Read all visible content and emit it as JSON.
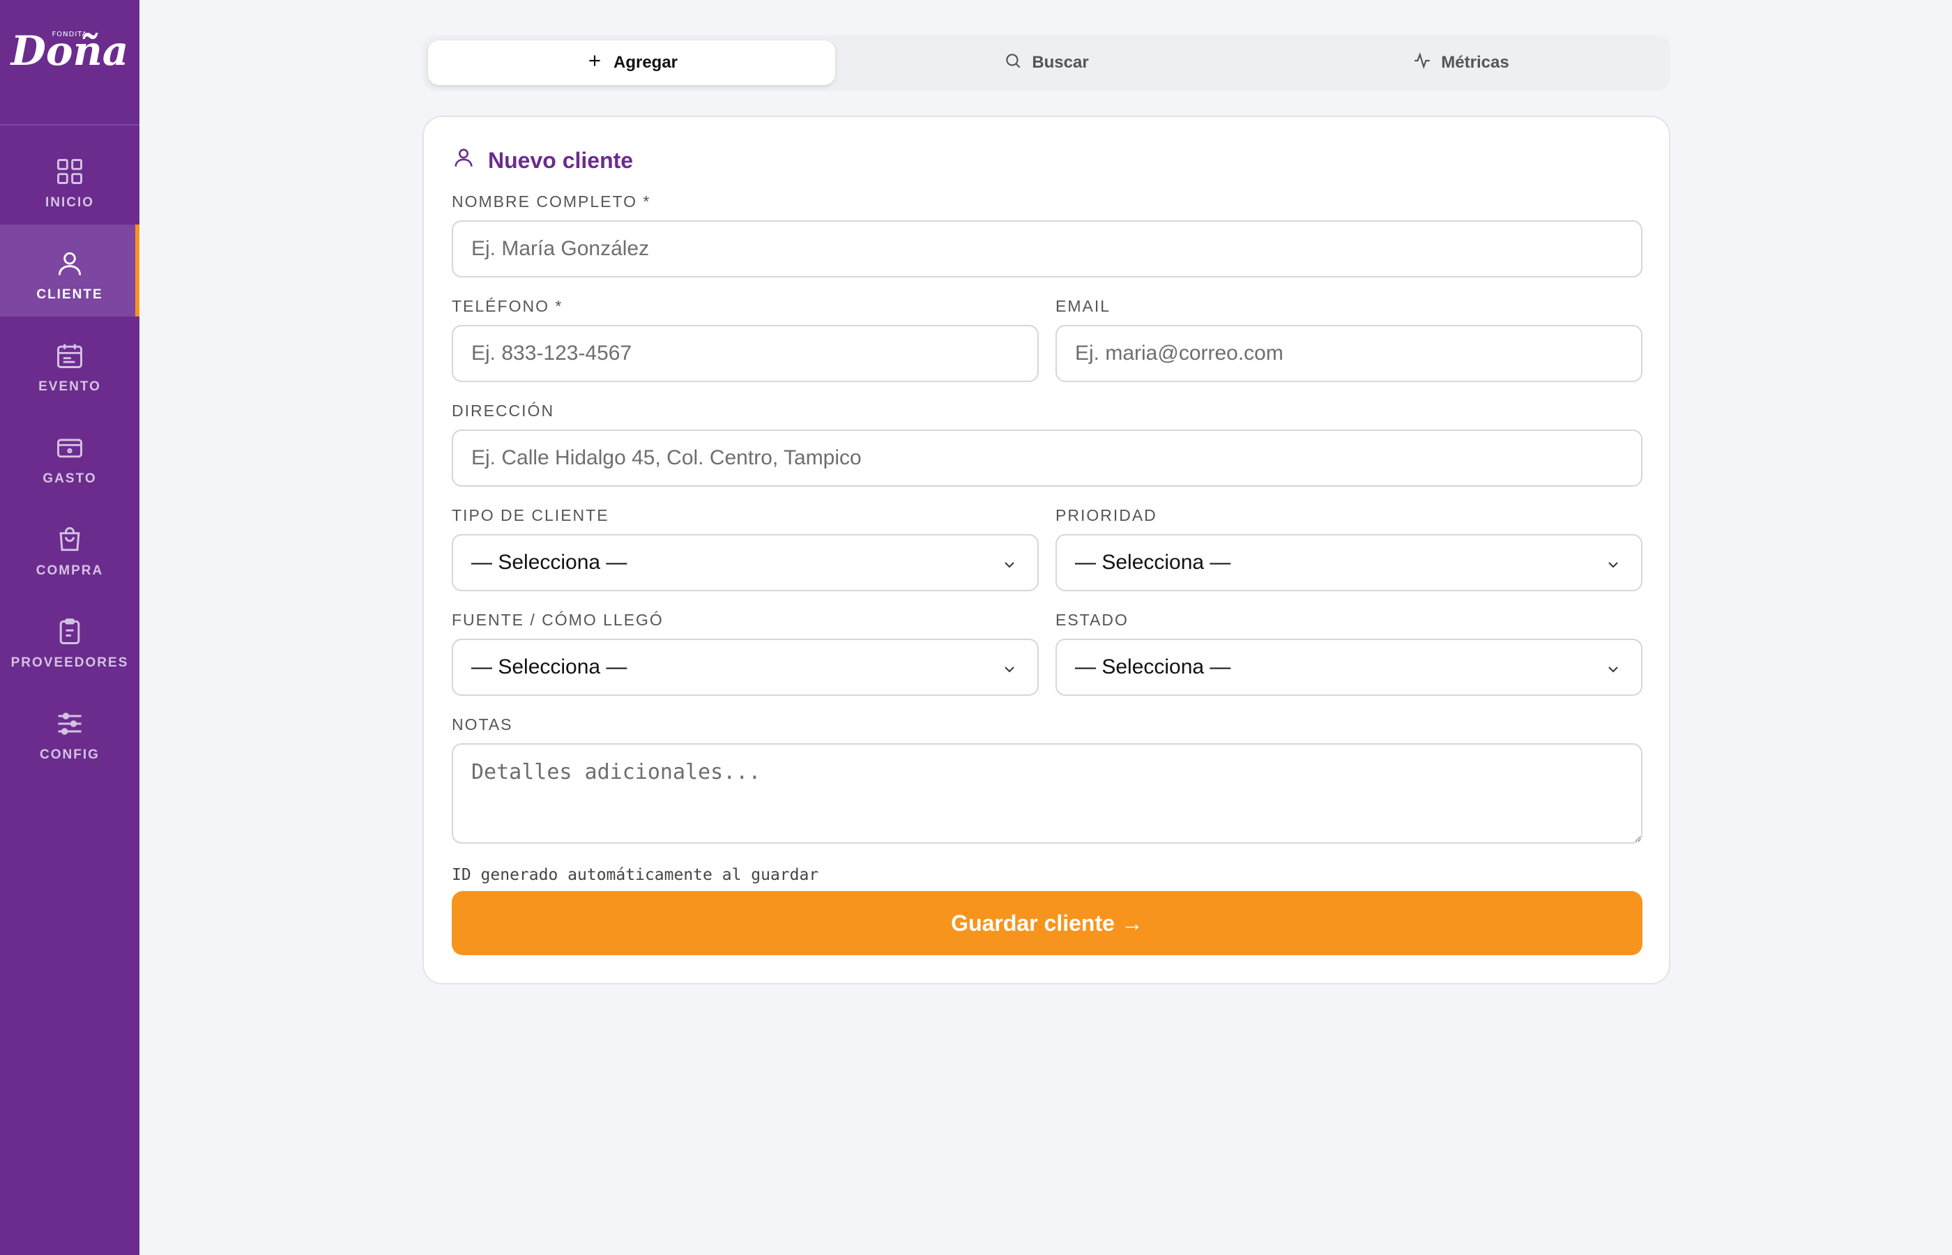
{
  "brand": {
    "small_text": "FONDITA",
    "name": "Doña"
  },
  "sidebar": {
    "items": [
      {
        "label": "INICIO",
        "icon": "grid-icon",
        "active": false
      },
      {
        "label": "CLIENTE",
        "icon": "user-icon",
        "active": true
      },
      {
        "label": "EVENTO",
        "icon": "calendar-icon",
        "active": false
      },
      {
        "label": "GASTO",
        "icon": "wallet-icon",
        "active": false
      },
      {
        "label": "COMPRA",
        "icon": "shopping-bag-icon",
        "active": false
      },
      {
        "label": "PROVEEDORES",
        "icon": "clipboard-icon",
        "active": false
      },
      {
        "label": "CONFIG",
        "icon": "sliders-icon",
        "active": false
      }
    ]
  },
  "tabs": [
    {
      "label": "Agregar",
      "icon": "plus-icon",
      "active": true
    },
    {
      "label": "Buscar",
      "icon": "search-icon",
      "active": false
    },
    {
      "label": "Métricas",
      "icon": "activity-icon",
      "active": false
    }
  ],
  "form": {
    "title": "Nuevo cliente",
    "fields": {
      "nombre": {
        "label": "NOMBRE COMPLETO *",
        "placeholder": "Ej. María González",
        "value": ""
      },
      "telefono": {
        "label": "TELÉFONO *",
        "placeholder": "Ej. 833-123-4567",
        "value": ""
      },
      "email": {
        "label": "EMAIL",
        "placeholder": "Ej. maria@correo.com",
        "value": ""
      },
      "direccion": {
        "label": "DIRECCIÓN",
        "placeholder": "Ej. Calle Hidalgo 45, Col. Centro, Tampico",
        "value": ""
      },
      "tipo": {
        "label": "TIPO DE CLIENTE",
        "selected": "— Selecciona —"
      },
      "prioridad": {
        "label": "PRIORIDAD",
        "selected": "— Selecciona —"
      },
      "fuente": {
        "label": "FUENTE / CÓMO LLEGÓ",
        "selected": "— Selecciona —"
      },
      "estado": {
        "label": "ESTADO",
        "selected": "— Selecciona —"
      },
      "notas": {
        "label": "NOTAS",
        "placeholder": "Detalles adicionales...",
        "value": ""
      }
    },
    "hint": "ID generado automáticamente al guardar",
    "save_label": "Guardar cliente →"
  },
  "colors": {
    "sidebar": "#6b2c8e",
    "accent": "#f7941e",
    "title": "#6b2c8e",
    "background": "#f4f5f8"
  }
}
